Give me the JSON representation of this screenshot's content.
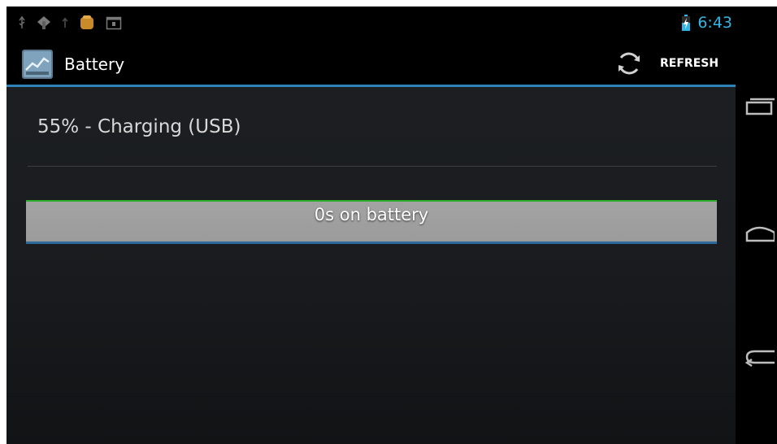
{
  "status_bar": {
    "time": "6:43",
    "left_icons": [
      "usb-icon",
      "android-debug-icon",
      "usb-small-icon",
      "app-notification-icon",
      "calendar-icon"
    ],
    "right_icons": [
      "battery-charging-icon"
    ]
  },
  "action_bar": {
    "title": "Battery",
    "refresh_label": "REFRESH",
    "app_icon": "battery-app-icon",
    "divider_color": "#2e84b8"
  },
  "content": {
    "battery_status": "55% - Charging (USB)",
    "usage_bar_label": "0s on battery",
    "charge_level_percent": 55
  },
  "nav_bar": {
    "buttons": [
      "recent-apps-icon",
      "home-icon",
      "back-icon"
    ]
  },
  "colors": {
    "accent": "#33b5e5",
    "charge_line": "#2eae2e",
    "bar_fill": "#a3a3a3"
  }
}
